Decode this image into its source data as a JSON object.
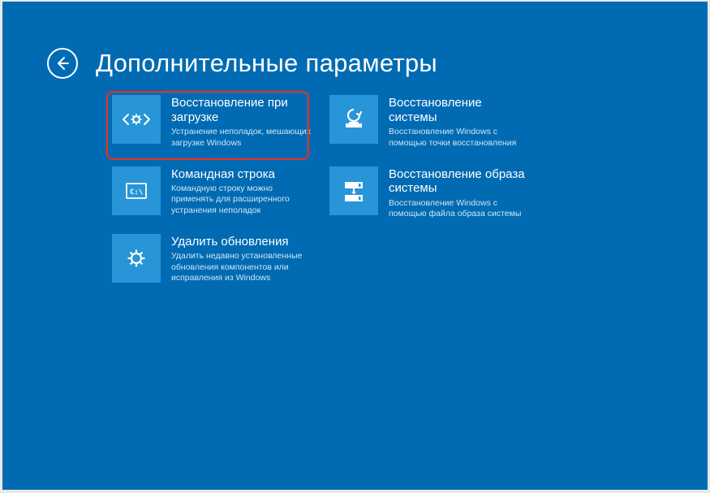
{
  "title": "Дополнительные параметры",
  "tiles_left": [
    {
      "title": "Восстановление при загрузке",
      "desc": "Устранение неполадок, мешающих загрузке Windows"
    },
    {
      "title": "Командная строка",
      "desc": "Командную строку можно применять для расширенного устранения неполадок"
    },
    {
      "title": "Удалить обновления",
      "desc": "Удалить недавно установленные обновления компонентов или исправления из Windows"
    }
  ],
  "tiles_right": [
    {
      "title": "Восстановление системы",
      "desc": "Восстановление Windows с помощью точки восстановления"
    },
    {
      "title": "Восстановление образа системы",
      "desc": "Восстановление Windows с помощью файла образа системы"
    }
  ]
}
